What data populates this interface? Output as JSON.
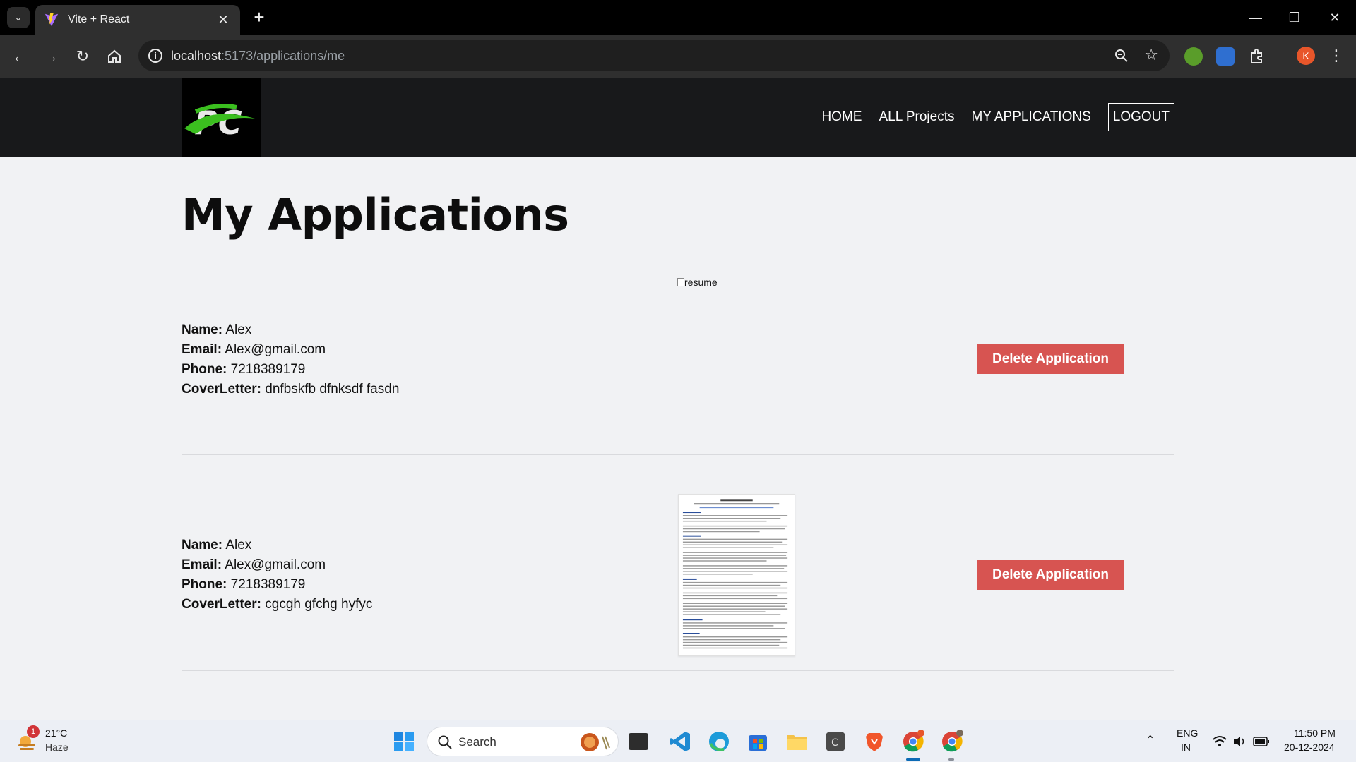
{
  "browser": {
    "tab_title": "Vite + React",
    "url_host": "localhost",
    "url_rest": ":5173/applications/me",
    "profile_initial": "K"
  },
  "site": {
    "nav": [
      "HOME",
      "ALL Projects",
      "MY APPLICATIONS",
      "LOGOUT"
    ],
    "page_title": "My Applications"
  },
  "applications": [
    {
      "name_label": "Name:",
      "name": "Alex",
      "email_label": "Email:",
      "email": "Alex@gmail.com",
      "phone_label": "Phone:",
      "phone": "7218389179",
      "cover_label": "CoverLetter:",
      "cover": "dnfbskfb dfnksdf fasdn",
      "resume_alt": "resume",
      "delete_label": "Delete Application"
    },
    {
      "name_label": "Name:",
      "name": "Alex",
      "email_label": "Email:",
      "email": "Alex@gmail.com",
      "phone_label": "Phone:",
      "phone": "7218389179",
      "cover_label": "CoverLetter:",
      "cover": "cgcgh gfchg hyfyc",
      "delete_label": "Delete Application"
    }
  ],
  "taskbar": {
    "weather_temp": "21°C",
    "weather_desc": "Haze",
    "weather_badge": "1",
    "search_placeholder": "Search",
    "lang_top": "ENG",
    "lang_bottom": "IN",
    "time": "11:50 PM",
    "date": "20-12-2024"
  },
  "colors": {
    "header_bg": "#18191b",
    "page_bg": "#f1f2f4",
    "delete_button": "#d75451",
    "logo_green": "#3bbf1f"
  }
}
